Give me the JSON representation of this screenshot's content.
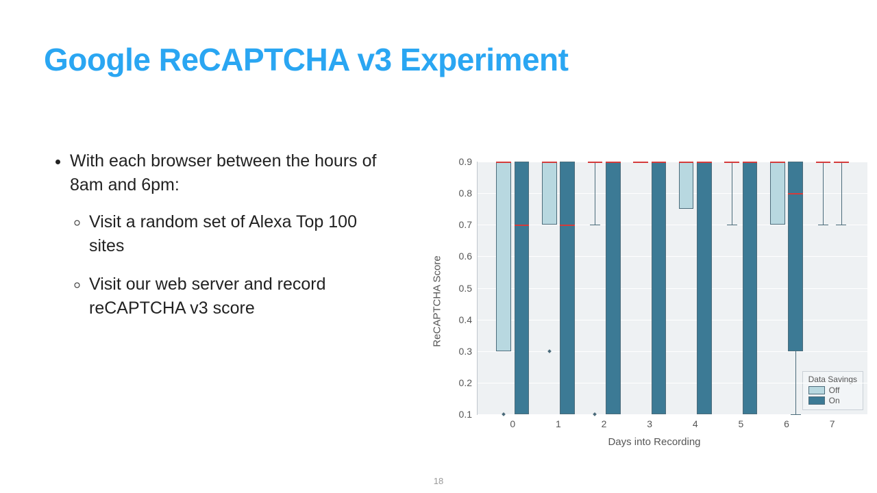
{
  "title": "Google ReCAPTCHA v3 Experiment",
  "page_number": "18",
  "bullets": {
    "b1": "With each browser between the hours of 8am and 6pm:",
    "b1a": "Visit a random set of Alexa Top 100 sites",
    "b1b": "Visit our web server and record reCAPTCHA v3 score"
  },
  "chart": {
    "ylabel": "ReCAPTCHA Score",
    "xlabel": "Days into Recording",
    "legend": {
      "title": "Data Savings",
      "off": "Off",
      "on": "On"
    }
  },
  "chart_data": {
    "type": "boxplot",
    "title": "",
    "xlabel": "Days into Recording",
    "ylabel": "ReCAPTCHA Score",
    "ylim": [
      0.1,
      0.9
    ],
    "yticks": [
      0.1,
      0.2,
      0.3,
      0.4,
      0.5,
      0.6,
      0.7,
      0.8,
      0.9
    ],
    "categories": [
      0,
      1,
      2,
      3,
      4,
      5,
      6,
      7
    ],
    "legend": {
      "title": "Data Savings",
      "entries": [
        "Off",
        "On"
      ]
    },
    "series": [
      {
        "name": "Off",
        "color": "#b8d8e0",
        "boxes": [
          {
            "x": 0,
            "q1": 0.3,
            "median": 0.9,
            "q3": 0.9,
            "wlo": 0.3,
            "whi": 0.9,
            "fliers": [
              0.1
            ]
          },
          {
            "x": 1,
            "q1": 0.7,
            "median": 0.9,
            "q3": 0.9,
            "wlo": 0.7,
            "whi": 0.9,
            "fliers": [
              0.3
            ]
          },
          {
            "x": 2,
            "q1": 0.9,
            "median": 0.9,
            "q3": 0.9,
            "wlo": 0.7,
            "whi": 0.9,
            "fliers": [
              0.1
            ]
          },
          {
            "x": 3,
            "q1": 0.9,
            "median": 0.9,
            "q3": 0.9,
            "wlo": 0.9,
            "whi": 0.9,
            "fliers": []
          },
          {
            "x": 4,
            "q1": 0.75,
            "median": 0.9,
            "q3": 0.9,
            "wlo": 0.75,
            "whi": 0.9,
            "fliers": []
          },
          {
            "x": 5,
            "q1": 0.9,
            "median": 0.9,
            "q3": 0.9,
            "wlo": 0.7,
            "whi": 0.9,
            "fliers": []
          },
          {
            "x": 6,
            "q1": 0.7,
            "median": 0.9,
            "q3": 0.9,
            "wlo": 0.7,
            "whi": 0.9,
            "fliers": []
          },
          {
            "x": 7,
            "q1": 0.9,
            "median": 0.9,
            "q3": 0.9,
            "wlo": 0.7,
            "whi": 0.9,
            "fliers": []
          }
        ]
      },
      {
        "name": "On",
        "color": "#3c7a95",
        "boxes": [
          {
            "x": 0,
            "q1": 0.1,
            "median": 0.7,
            "q3": 0.9,
            "wlo": 0.1,
            "whi": 0.9,
            "fliers": []
          },
          {
            "x": 1,
            "q1": 0.1,
            "median": 0.7,
            "q3": 0.9,
            "wlo": 0.1,
            "whi": 0.9,
            "fliers": []
          },
          {
            "x": 2,
            "q1": 0.1,
            "median": 0.9,
            "q3": 0.9,
            "wlo": 0.1,
            "whi": 0.9,
            "fliers": []
          },
          {
            "x": 3,
            "q1": 0.1,
            "median": 0.9,
            "q3": 0.9,
            "wlo": 0.1,
            "whi": 0.9,
            "fliers": []
          },
          {
            "x": 4,
            "q1": 0.1,
            "median": 0.9,
            "q3": 0.9,
            "wlo": 0.1,
            "whi": 0.9,
            "fliers": []
          },
          {
            "x": 5,
            "q1": 0.1,
            "median": 0.9,
            "q3": 0.9,
            "wlo": 0.1,
            "whi": 0.9,
            "fliers": []
          },
          {
            "x": 6,
            "q1": 0.3,
            "median": 0.8,
            "q3": 0.9,
            "wlo": 0.1,
            "whi": 0.9,
            "fliers": []
          },
          {
            "x": 7,
            "q1": 0.9,
            "median": 0.9,
            "q3": 0.9,
            "wlo": 0.7,
            "whi": 0.9,
            "fliers": []
          }
        ]
      }
    ]
  }
}
